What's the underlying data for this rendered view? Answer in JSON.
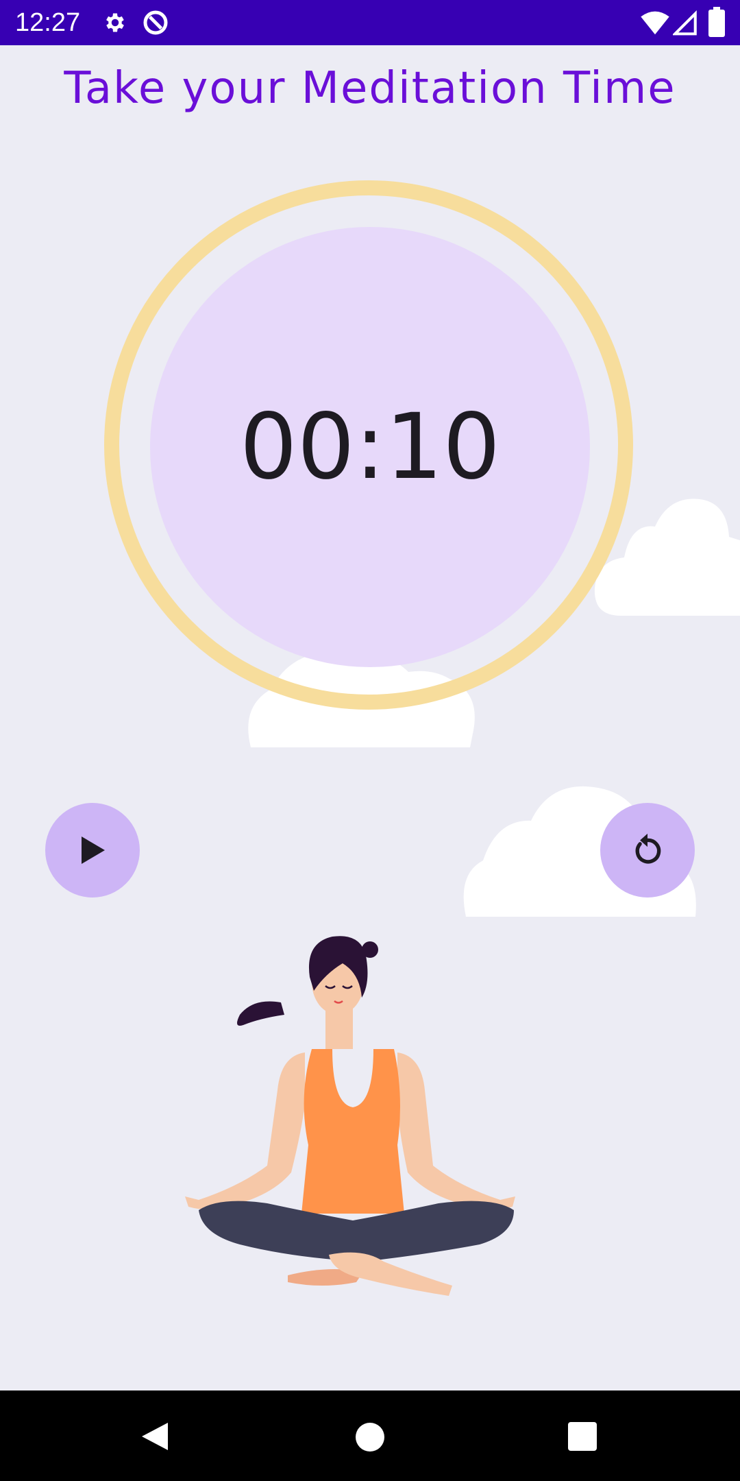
{
  "status_bar": {
    "time": "12:27",
    "icons": [
      "gear-icon",
      "data-saver-icon",
      "wifi-icon",
      "signal-icon",
      "battery-icon"
    ]
  },
  "header": {
    "title": "Take your Meditation Time"
  },
  "timer": {
    "display": "00:10"
  },
  "controls": {
    "play_icon": "play-icon",
    "reset_icon": "replay-icon"
  },
  "nav_bar": {
    "icons": [
      "back-icon",
      "home-icon",
      "recents-icon"
    ]
  },
  "colors": {
    "status_bar": "#3700b3",
    "title": "#6a0fd8",
    "ring": "#f7dd9c",
    "timer_circle": "#e7d9fa",
    "button": "#cdb5f6",
    "background": "#ececf4"
  }
}
